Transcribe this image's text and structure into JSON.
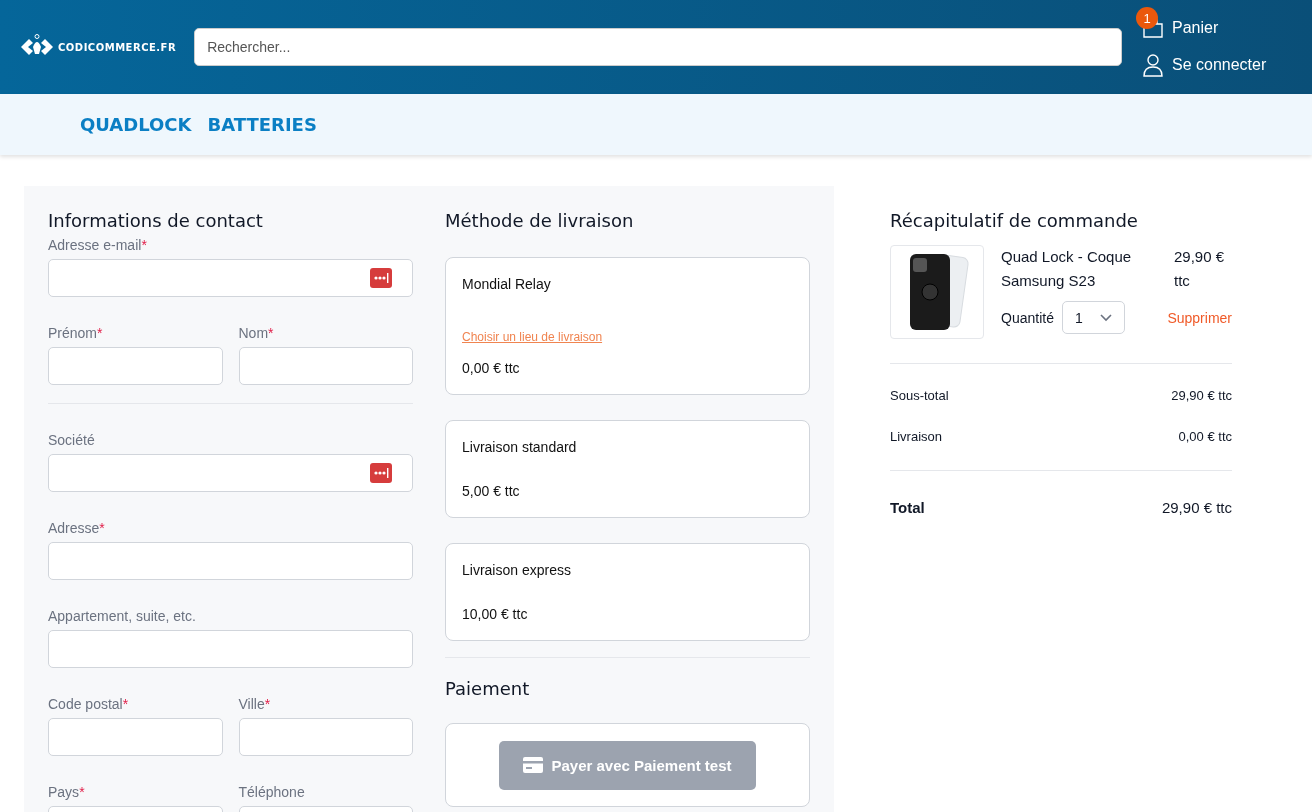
{
  "header": {
    "logo_text": "CODICOMMERCE.FR",
    "search": {
      "placeholder": "Rechercher..."
    },
    "cart": {
      "label": "Panier",
      "badge": "1"
    },
    "account": {
      "label": "Se connecter"
    }
  },
  "nav": {
    "links": [
      "QUADLOCK",
      "BATTERIES"
    ]
  },
  "contact": {
    "title": "Informations de contact",
    "rows": [
      {
        "kind": "fields",
        "fields": [
          {
            "label": "Adresse e-mail",
            "required_mark": "*",
            "autofill_icon": true
          }
        ]
      },
      {
        "kind": "fields",
        "fields": [
          {
            "label": "Prénom",
            "required_mark": "*",
            "autofill_icon": false
          },
          {
            "label": "Nom",
            "required_mark": "*",
            "autofill_icon": false
          }
        ]
      },
      {
        "kind": "divider"
      },
      {
        "kind": "fields",
        "fields": [
          {
            "label": "Société",
            "autofill_icon": true
          }
        ]
      },
      {
        "kind": "fields",
        "fields": [
          {
            "label": "Adresse",
            "required_mark": "*",
            "autofill_icon": false
          }
        ]
      },
      {
        "kind": "fields",
        "fields": [
          {
            "label": "Appartement, suite, etc.",
            "autofill_icon": false
          }
        ]
      },
      {
        "kind": "fields",
        "fields": [
          {
            "label": "Code postal",
            "required_mark": "*",
            "autofill_icon": false
          },
          {
            "label": "Ville",
            "required_mark": "*",
            "autofill_icon": false
          }
        ]
      },
      {
        "kind": "fields",
        "fields": [
          {
            "label": "Pays",
            "required_mark": "*",
            "autofill_icon": false
          },
          {
            "label": "Téléphone",
            "autofill_icon": false
          }
        ]
      }
    ]
  },
  "shipping": {
    "title": "Méthode de livraison",
    "methods": [
      {
        "name": "Mondial Relay",
        "link": "Choisir un lieu de livraison",
        "price": "0,00 € ttc"
      },
      {
        "name": "Livraison standard",
        "price": "5,00 € ttc"
      },
      {
        "name": "Livraison express",
        "price": "10,00 € ttc"
      }
    ]
  },
  "payment": {
    "title": "Paiement",
    "button": {
      "label": "Payer avec Paiement test",
      "disabled": true
    }
  },
  "summary": {
    "title": "Récapitulatif de commande",
    "item": {
      "name": "Quad Lock - Coque Samsung S23",
      "price": "29,90 € ttc",
      "quantity_label": "Quantité",
      "quantity": "1",
      "remove": "Supprimer"
    },
    "lines": [
      {
        "label": "Sous-total",
        "value": "29,90 € ttc"
      },
      {
        "label": "Livraison",
        "value": "0,00 € ttc"
      }
    ],
    "total": {
      "label": "Total",
      "value": "29,90 € ttc"
    }
  }
}
